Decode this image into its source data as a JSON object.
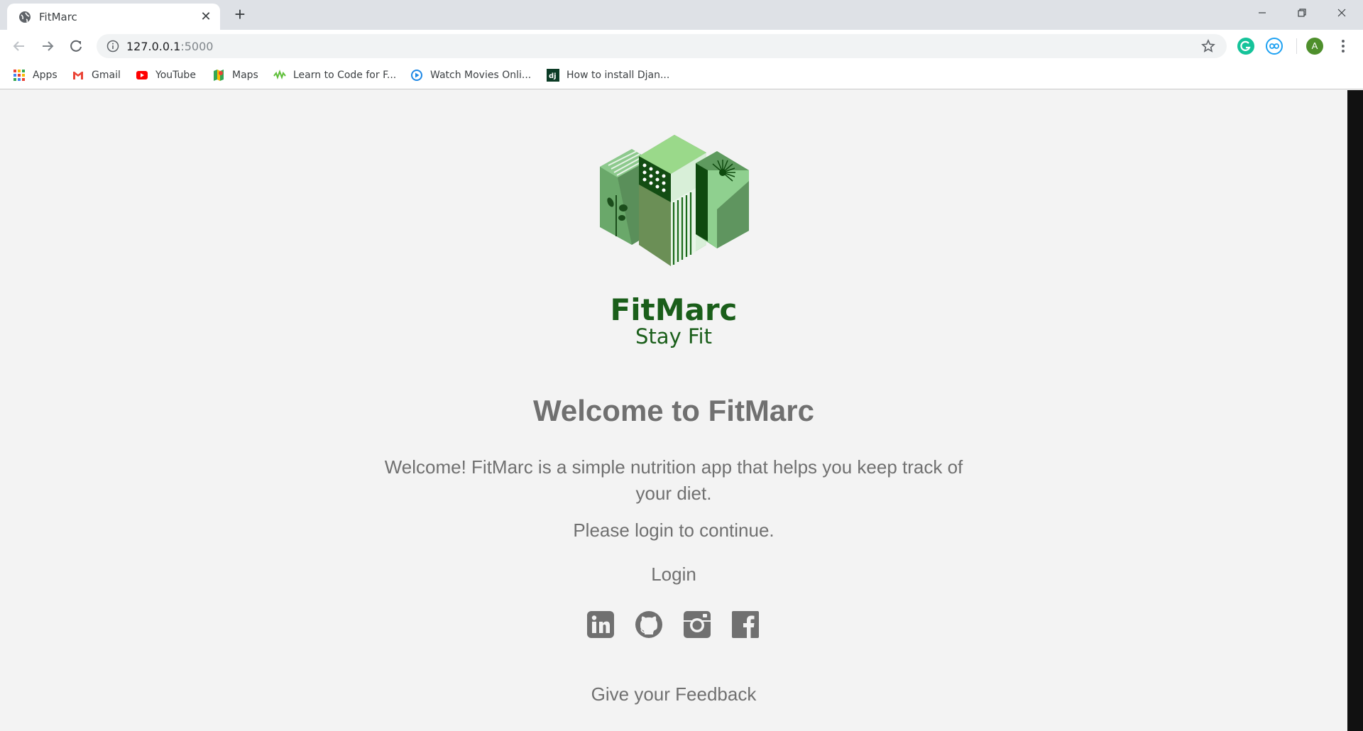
{
  "browser": {
    "tab_title": "FitMarc",
    "url_host": "127.0.0.1",
    "url_port": ":5000",
    "profile_initial": "A",
    "bookmarks": [
      {
        "label": "Apps",
        "icon": "apps-grid-icon"
      },
      {
        "label": "Gmail",
        "icon": "gmail-icon"
      },
      {
        "label": "YouTube",
        "icon": "youtube-icon"
      },
      {
        "label": "Maps",
        "icon": "maps-icon"
      },
      {
        "label": "Learn to Code for F...",
        "icon": "freecodecamp-icon"
      },
      {
        "label": "Watch Movies Onli...",
        "icon": "play-icon"
      },
      {
        "label": "How to install Djan...",
        "icon": "django-icon"
      }
    ]
  },
  "page": {
    "brand": "FitMarc",
    "tagline": "Stay Fit",
    "heading": "Welcome to FitMarc",
    "description": "Welcome! FitMarc is a simple nutrition app that helps you keep track of your diet.",
    "prompt": "Please login to continue.",
    "login_label": "Login",
    "feedback_label": "Give your Feedback",
    "social_links": [
      "linkedin-icon",
      "github-icon",
      "instagram-icon",
      "facebook-icon"
    ]
  },
  "colors": {
    "brand_green": "#1a5e1a",
    "text_gray": "#707070",
    "page_bg": "#f3f3f3"
  }
}
